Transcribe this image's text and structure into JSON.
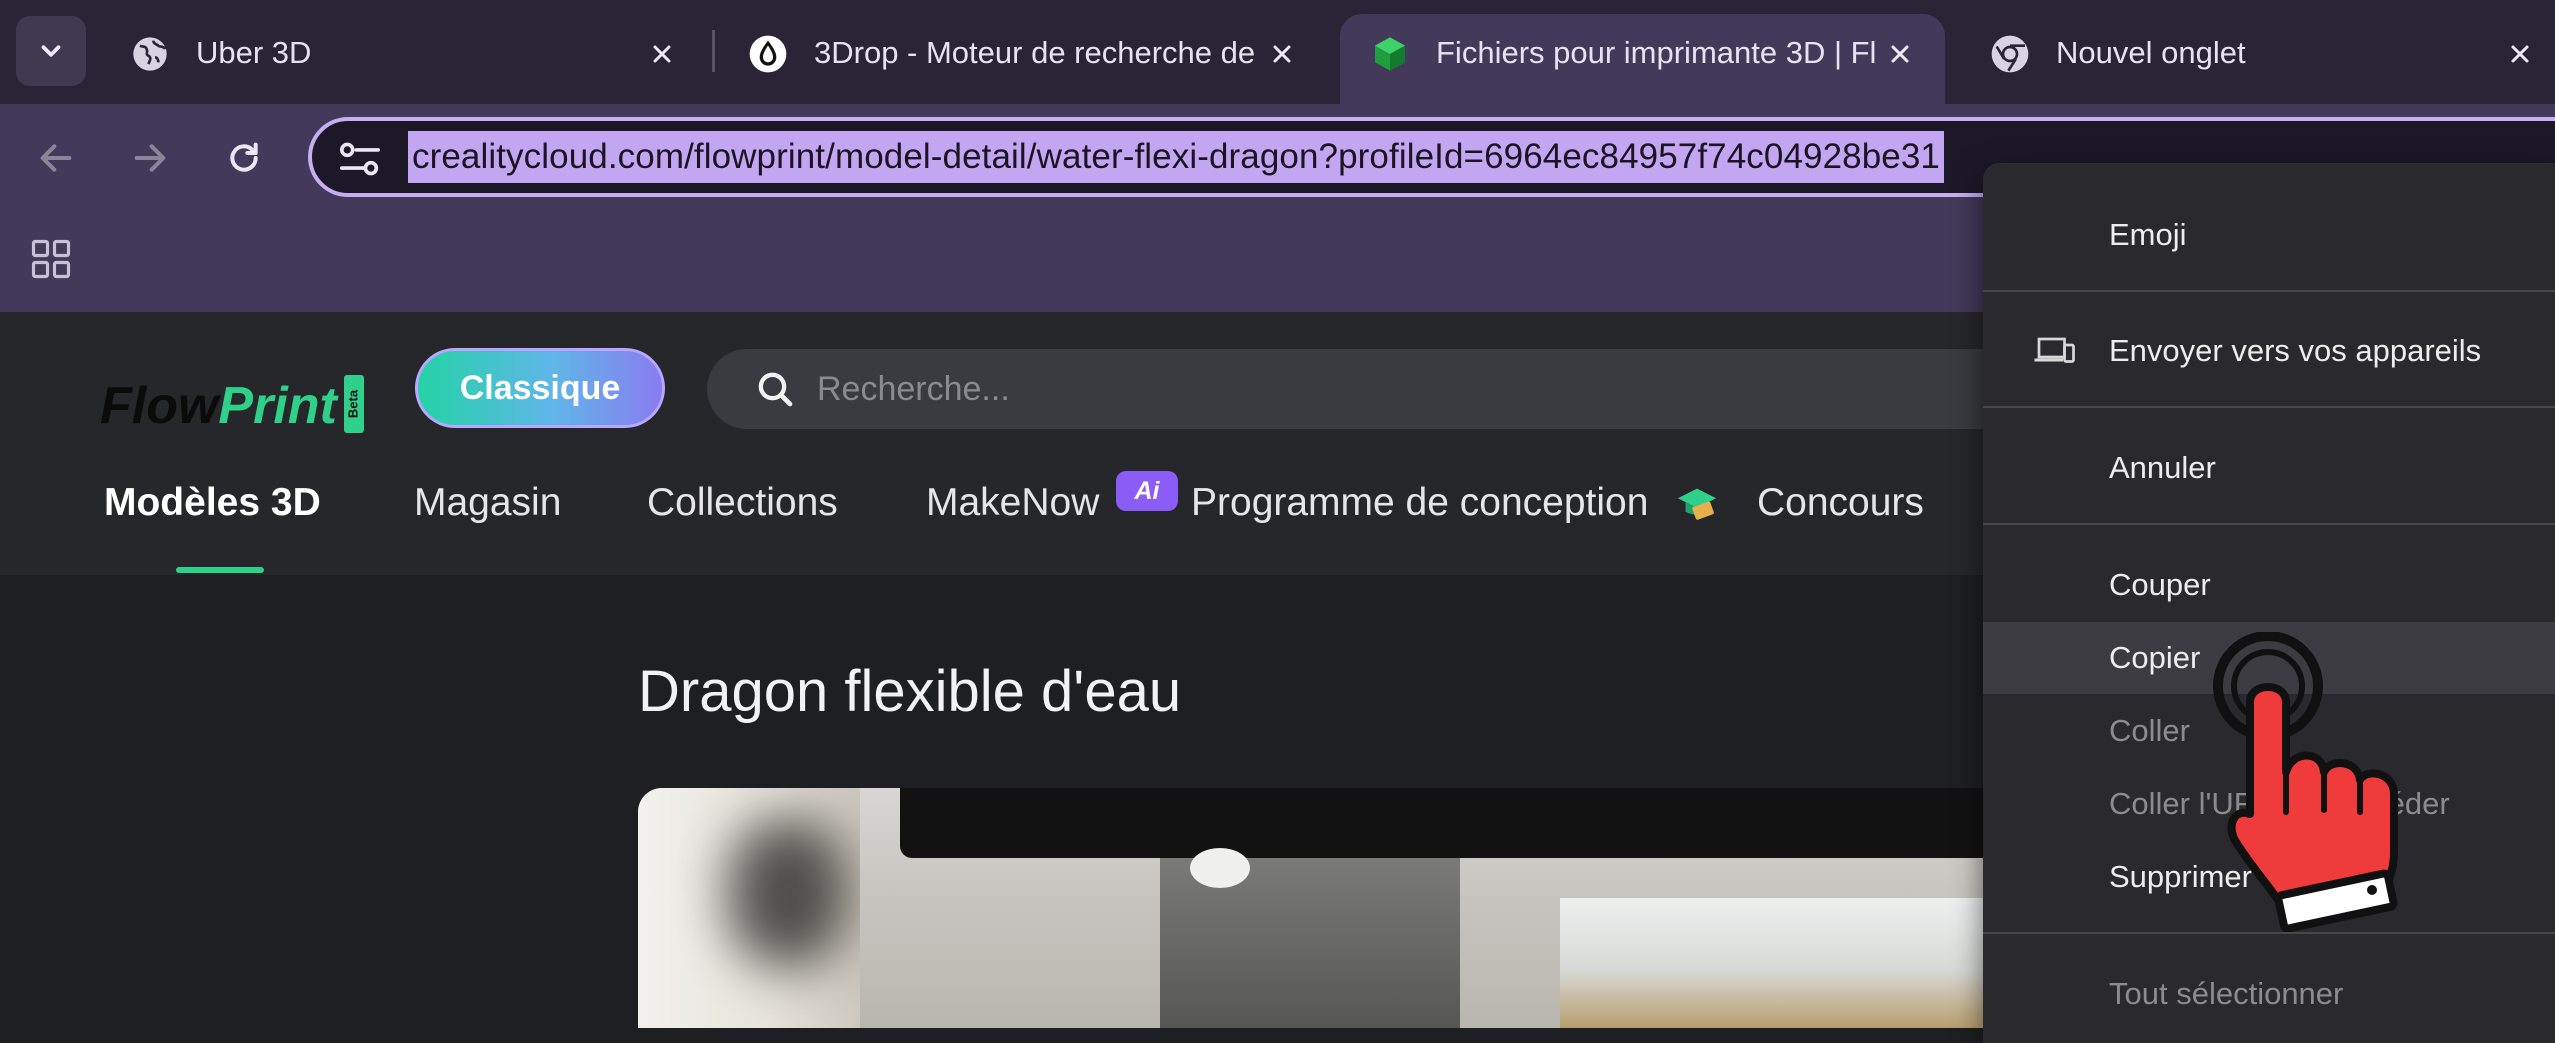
{
  "tabs": [
    {
      "title": "Uber 3D",
      "active": false
    },
    {
      "title": "3Drop - Moteur de recherche de",
      "active": false
    },
    {
      "title": "Fichiers pour imprimante 3D | Fl",
      "active": true
    },
    {
      "title": "Nouvel onglet",
      "active": false
    }
  ],
  "omnibox": {
    "url": "crealitycloud.com/flowprint/model-detail/water-flexi-dragon?profileId=6964ec84957f74c04928be31"
  },
  "site": {
    "logo_flow": "Flow",
    "logo_print": "Print",
    "logo_beta": "Beta",
    "classic_button": "Classique",
    "search_placeholder": "Recherche...",
    "nav": [
      "Modèles 3D",
      "Magasin",
      "Collections",
      "MakeNow",
      "Programme de conception",
      "Concours"
    ],
    "ai_badge": "Ai",
    "model_title": "Dragon flexible d'eau"
  },
  "context_menu": {
    "items": [
      {
        "label": "Emoji",
        "disabled": false
      },
      {
        "label": "Envoyer vers vos appareils",
        "disabled": false,
        "icon": "devices-icon"
      },
      {
        "label": "Annuler",
        "disabled": false
      },
      {
        "label": "Couper",
        "disabled": false
      },
      {
        "label": "Copier",
        "disabled": false,
        "highlighted": true
      },
      {
        "label": "Coller",
        "disabled": true
      },
      {
        "label": "Coller l'URL et y accéder",
        "disabled": true
      },
      {
        "label": "Supprimer",
        "disabled": false
      },
      {
        "label": "Tout sélectionner",
        "disabled": true
      }
    ]
  },
  "colors": {
    "accent_green": "#2fd08a",
    "selection": "#c3a6f2",
    "tab_strip": "#2b2336",
    "toolbar": "#43395a",
    "cursor_red": "#ef3b3b"
  }
}
